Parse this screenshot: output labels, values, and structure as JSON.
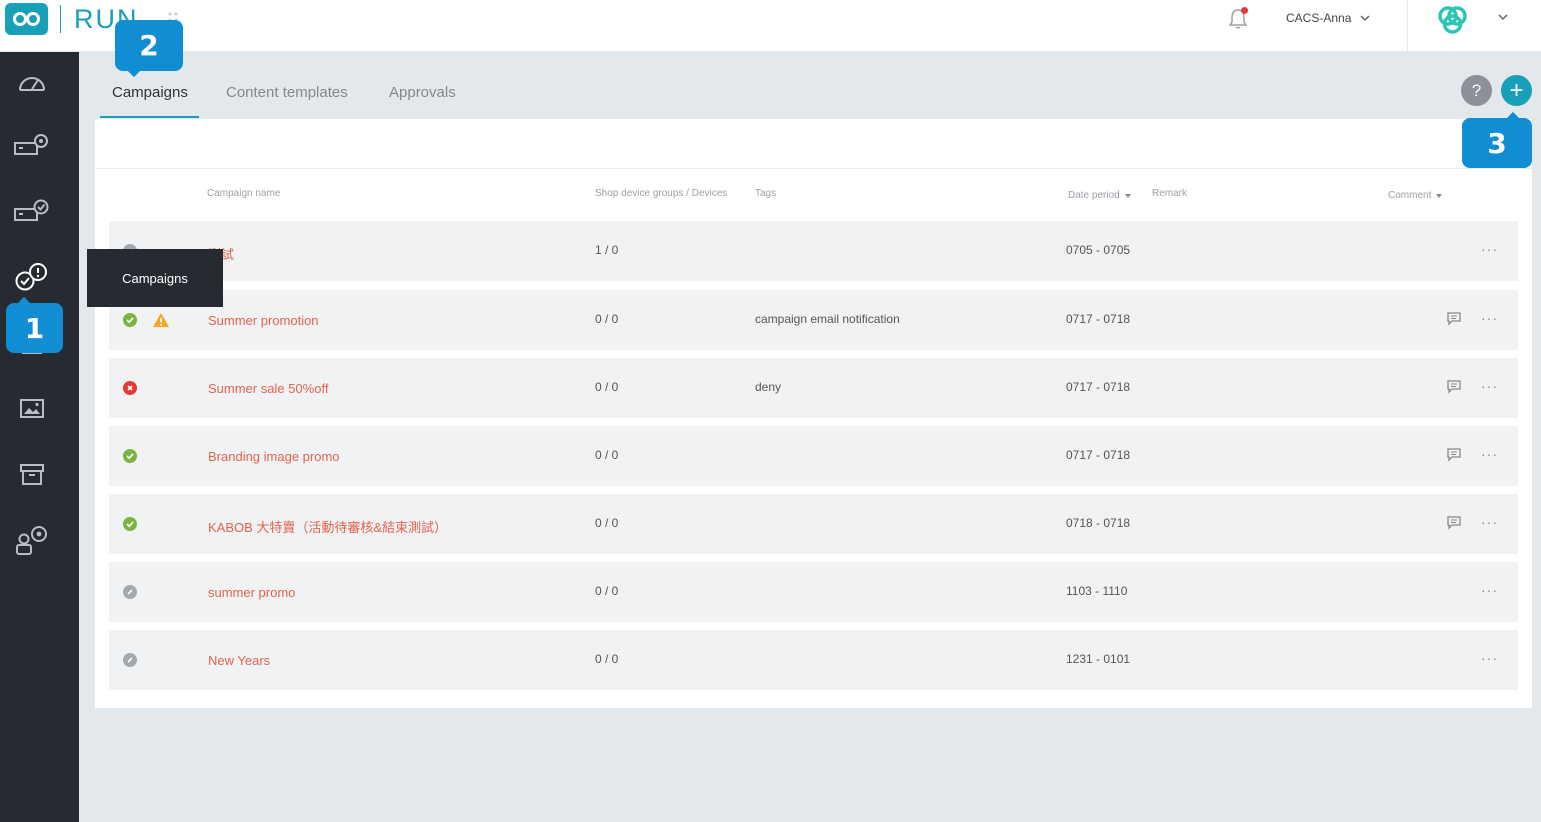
{
  "app": {
    "name": "RUN"
  },
  "header": {
    "user": "CACS-Anna"
  },
  "sidebar": {
    "items": [
      {
        "icon": "dashboard-icon"
      },
      {
        "icon": "device-settings-icon"
      },
      {
        "icon": "device-check-icon"
      },
      {
        "icon": "campaigns-icon"
      },
      {
        "icon": "content-icon"
      },
      {
        "icon": "image-icon"
      },
      {
        "icon": "archive-icon"
      },
      {
        "icon": "user-settings-icon"
      }
    ],
    "tooltip": "Campaigns"
  },
  "callouts": {
    "one": "1",
    "two": "2",
    "three": "3"
  },
  "tabs": [
    {
      "label": "Campaigns",
      "active": true
    },
    {
      "label": "Content templates",
      "active": false
    },
    {
      "label": "Approvals",
      "active": false
    }
  ],
  "actions": {
    "help": "?",
    "add": "+"
  },
  "table": {
    "headers": {
      "name": "Campaign name",
      "devices": "Shop device groups / Devices",
      "tags": "Tags",
      "date": "Date period",
      "remark": "Remark",
      "comment": "Comment"
    },
    "rows": [
      {
        "status": "draft",
        "name": "測試",
        "devices": "1 / 0",
        "tags": "",
        "date": "0705 - 0705",
        "comment": false,
        "warning": false
      },
      {
        "status": "approved",
        "name": "Summer promotion",
        "devices": "0 / 0",
        "tags": "campaign email notification",
        "date": "0717 - 0718",
        "comment": true,
        "warning": true
      },
      {
        "status": "rejected",
        "name": "Summer sale 50%off",
        "devices": "0 / 0",
        "tags": "deny",
        "date": "0717 - 0718",
        "comment": true,
        "warning": false
      },
      {
        "status": "approved",
        "name": "Branding image promo",
        "devices": "0 / 0",
        "tags": "",
        "date": "0717 - 0718",
        "comment": true,
        "warning": false
      },
      {
        "status": "approved",
        "name": "KABOB 大特賣（活動待審核&結束測試）",
        "devices": "0 / 0",
        "tags": "",
        "date": "0718 - 0718",
        "comment": true,
        "warning": false
      },
      {
        "status": "draft",
        "name": "summer promo",
        "devices": "0 / 0",
        "tags": "",
        "date": "1103 - 1110",
        "comment": false,
        "warning": false
      },
      {
        "status": "draft",
        "name": "New Years",
        "devices": "0 / 0",
        "tags": "",
        "date": "1231 - 0101",
        "comment": false,
        "warning": false
      }
    ],
    "more_label": "···"
  },
  "colors": {
    "accent": "#17a0b8",
    "sidebar": "#262b31",
    "link": "#e5634a",
    "callout": "#118ed3"
  }
}
